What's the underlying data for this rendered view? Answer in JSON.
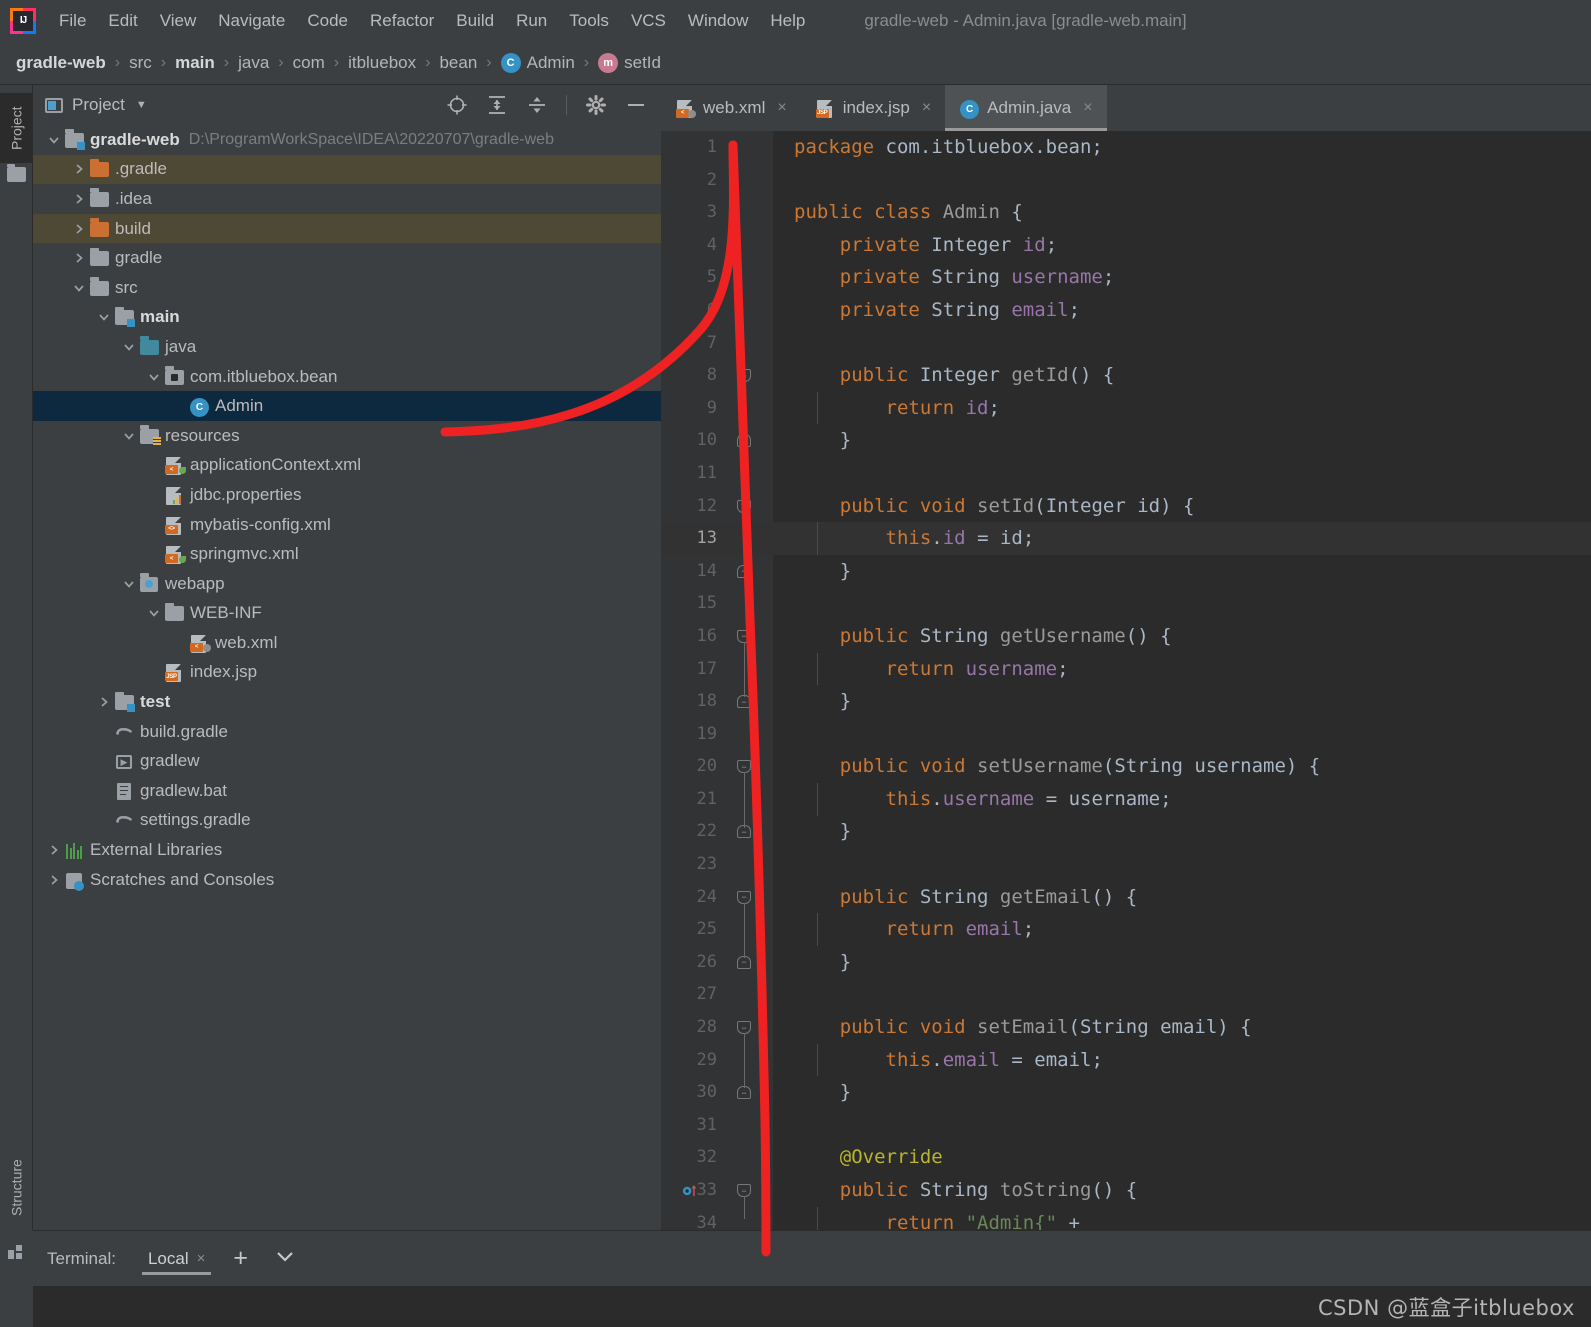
{
  "app": {
    "logo": "intellij-idea-logo",
    "window_title": "gradle-web - Admin.java [gradle-web.main]"
  },
  "menubar": {
    "items": [
      {
        "label": "File"
      },
      {
        "label": "Edit"
      },
      {
        "label": "View"
      },
      {
        "label": "Navigate"
      },
      {
        "label": "Code"
      },
      {
        "label": "Refactor"
      },
      {
        "label": "Build"
      },
      {
        "label": "Run"
      },
      {
        "label": "Tools"
      },
      {
        "label": "VCS"
      },
      {
        "label": "Window"
      },
      {
        "label": "Help"
      }
    ]
  },
  "breadcrumb": {
    "items": [
      {
        "label": "gradle-web",
        "bold": true,
        "icon": ""
      },
      {
        "label": "src",
        "bold": false,
        "icon": ""
      },
      {
        "label": "main",
        "bold": true,
        "icon": ""
      },
      {
        "label": "java",
        "bold": false,
        "icon": ""
      },
      {
        "label": "com",
        "bold": false,
        "icon": ""
      },
      {
        "label": "itbluebox",
        "bold": false,
        "icon": ""
      },
      {
        "label": "bean",
        "bold": false,
        "icon": ""
      },
      {
        "label": "Admin",
        "bold": false,
        "icon": "class-badge"
      },
      {
        "label": "setId",
        "bold": false,
        "icon": "method-badge"
      }
    ],
    "separator": "›",
    "class_badge_letter": "C",
    "method_badge_letter": "m"
  },
  "toolstrip": {
    "project_label": "Project",
    "structure_label": "Structure"
  },
  "project_panel": {
    "title": "Project",
    "caret": "▼",
    "toolbar_icons": [
      "locate-target-icon",
      "expand-all-icon",
      "collapse-all-icon",
      "gear-icon",
      "minimize-icon"
    ],
    "tree": [
      {
        "depth": 0,
        "label": "gradle-web",
        "path": "D:\\ProgramWorkSpace\\IDEA\\20220707\\gradle-web",
        "arrow": "down",
        "icon": "module-folder",
        "bold": true,
        "state": "normal"
      },
      {
        "depth": 1,
        "label": ".gradle",
        "path": "",
        "arrow": "right",
        "icon": "folder-orange",
        "bold": false,
        "state": "excluded"
      },
      {
        "depth": 1,
        "label": ".idea",
        "path": "",
        "arrow": "right",
        "icon": "folder-gray",
        "bold": false,
        "state": "normal"
      },
      {
        "depth": 1,
        "label": "build",
        "path": "",
        "arrow": "right",
        "icon": "folder-orange",
        "bold": false,
        "state": "excluded"
      },
      {
        "depth": 1,
        "label": "gradle",
        "path": "",
        "arrow": "right",
        "icon": "folder-gray",
        "bold": false,
        "state": "normal"
      },
      {
        "depth": 1,
        "label": "src",
        "path": "",
        "arrow": "down",
        "icon": "folder-gray",
        "bold": false,
        "state": "normal"
      },
      {
        "depth": 2,
        "label": "main",
        "path": "",
        "arrow": "down",
        "icon": "module-folder",
        "bold": true,
        "state": "normal"
      },
      {
        "depth": 3,
        "label": "java",
        "path": "",
        "arrow": "down",
        "icon": "folder-teal",
        "bold": false,
        "state": "normal"
      },
      {
        "depth": 4,
        "label": "com.itbluebox.bean",
        "path": "",
        "arrow": "down",
        "icon": "package-icon",
        "bold": false,
        "state": "normal"
      },
      {
        "depth": 5,
        "label": "Admin",
        "path": "",
        "arrow": "none",
        "icon": "java-class",
        "bold": false,
        "state": "selected"
      },
      {
        "depth": 3,
        "label": "resources",
        "path": "",
        "arrow": "down",
        "icon": "folder-resources",
        "bold": false,
        "state": "normal"
      },
      {
        "depth": 4,
        "label": "applicationContext.xml",
        "path": "",
        "arrow": "none",
        "icon": "spring-xml",
        "bold": false,
        "state": "normal"
      },
      {
        "depth": 4,
        "label": "jdbc.properties",
        "path": "",
        "arrow": "none",
        "icon": "properties-file",
        "bold": false,
        "state": "normal"
      },
      {
        "depth": 4,
        "label": "mybatis-config.xml",
        "path": "",
        "arrow": "none",
        "icon": "xml-file",
        "bold": false,
        "state": "normal"
      },
      {
        "depth": 4,
        "label": "springmvc.xml",
        "path": "",
        "arrow": "none",
        "icon": "spring-xml",
        "bold": false,
        "state": "normal"
      },
      {
        "depth": 3,
        "label": "webapp",
        "path": "",
        "arrow": "down",
        "icon": "webapp-folder",
        "bold": false,
        "state": "normal"
      },
      {
        "depth": 4,
        "label": "WEB-INF",
        "path": "",
        "arrow": "down",
        "icon": "folder-gray",
        "bold": false,
        "state": "normal"
      },
      {
        "depth": 5,
        "label": "web.xml",
        "path": "",
        "arrow": "none",
        "icon": "web-xml",
        "bold": false,
        "state": "normal"
      },
      {
        "depth": 4,
        "label": "index.jsp",
        "path": "",
        "arrow": "none",
        "icon": "jsp-file",
        "bold": false,
        "state": "normal"
      },
      {
        "depth": 2,
        "label": "test",
        "path": "",
        "arrow": "right",
        "icon": "module-folder",
        "bold": true,
        "state": "normal"
      },
      {
        "depth": 2,
        "label": "build.gradle",
        "path": "",
        "arrow": "none",
        "icon": "gradle-file",
        "bold": false,
        "state": "normal"
      },
      {
        "depth": 2,
        "label": "gradlew",
        "path": "",
        "arrow": "none",
        "icon": "script-file",
        "bold": false,
        "state": "normal"
      },
      {
        "depth": 2,
        "label": "gradlew.bat",
        "path": "",
        "arrow": "none",
        "icon": "bat-file",
        "bold": false,
        "state": "normal"
      },
      {
        "depth": 2,
        "label": "settings.gradle",
        "path": "",
        "arrow": "none",
        "icon": "gradle-file",
        "bold": false,
        "state": "normal"
      },
      {
        "depth": 0,
        "label": "External Libraries",
        "path": "",
        "arrow": "right",
        "icon": "libraries-icon",
        "bold": false,
        "state": "normal"
      },
      {
        "depth": 0,
        "label": "Scratches and Consoles",
        "path": "",
        "arrow": "right",
        "icon": "scratches-icon",
        "bold": false,
        "state": "normal"
      }
    ]
  },
  "editor": {
    "tabs": [
      {
        "label": "web.xml",
        "icon": "web-xml-icon",
        "active": false,
        "close": "×"
      },
      {
        "label": "index.jsp",
        "icon": "jsp-icon",
        "active": false,
        "close": "×"
      },
      {
        "label": "Admin.java",
        "icon": "java-class-icon",
        "active": true,
        "close": "×"
      }
    ],
    "current_line": 13,
    "first_line": 1,
    "last_line": 34,
    "lines": [
      {
        "n": 1,
        "fold": "none",
        "tokens": [
          {
            "t": "package ",
            "c": "kw"
          },
          {
            "t": "com.itbluebox.bean;",
            "c": "pln"
          }
        ]
      },
      {
        "n": 2,
        "fold": "none",
        "tokens": []
      },
      {
        "n": 3,
        "fold": "none",
        "tokens": [
          {
            "t": "public class ",
            "c": "kw"
          },
          {
            "t": "Admin",
            "c": "mth"
          },
          {
            "t": " {",
            "c": "pln"
          }
        ]
      },
      {
        "n": 4,
        "fold": "none",
        "tokens": [
          {
            "t": "    private ",
            "c": "kw"
          },
          {
            "t": "Integer ",
            "c": "typ"
          },
          {
            "t": "id",
            "c": "fld"
          },
          {
            "t": ";",
            "c": "pln"
          }
        ]
      },
      {
        "n": 5,
        "fold": "none",
        "tokens": [
          {
            "t": "    private ",
            "c": "kw"
          },
          {
            "t": "String ",
            "c": "typ"
          },
          {
            "t": "username",
            "c": "fld"
          },
          {
            "t": ";",
            "c": "pln"
          }
        ]
      },
      {
        "n": 6,
        "fold": "none",
        "tokens": [
          {
            "t": "    private ",
            "c": "kw"
          },
          {
            "t": "String ",
            "c": "typ"
          },
          {
            "t": "email",
            "c": "fld"
          },
          {
            "t": ";",
            "c": "pln"
          }
        ]
      },
      {
        "n": 7,
        "fold": "none",
        "tokens": []
      },
      {
        "n": 8,
        "fold": "open",
        "tokens": [
          {
            "t": "    public ",
            "c": "kw"
          },
          {
            "t": "Integer ",
            "c": "typ"
          },
          {
            "t": "getId",
            "c": "mth"
          },
          {
            "t": "() {",
            "c": "pln"
          }
        ]
      },
      {
        "n": 9,
        "fold": "none",
        "tokens": [
          {
            "t": "        return ",
            "c": "kw"
          },
          {
            "t": "id",
            "c": "fld"
          },
          {
            "t": ";",
            "c": "pln"
          }
        ]
      },
      {
        "n": 10,
        "fold": "close",
        "tokens": [
          {
            "t": "    }",
            "c": "pln"
          }
        ]
      },
      {
        "n": 11,
        "fold": "none",
        "tokens": []
      },
      {
        "n": 12,
        "fold": "open",
        "tokens": [
          {
            "t": "    public void ",
            "c": "kw"
          },
          {
            "t": "setId",
            "c": "mth"
          },
          {
            "t": "(",
            "c": "pln"
          },
          {
            "t": "Integer",
            "c": "typ"
          },
          {
            "t": " id) {",
            "c": "pln"
          }
        ]
      },
      {
        "n": 13,
        "fold": "none",
        "tokens": [
          {
            "t": "        this",
            "c": "kw"
          },
          {
            "t": ".",
            "c": "pln"
          },
          {
            "t": "id",
            "c": "fld"
          },
          {
            "t": " = id;",
            "c": "pln"
          }
        ]
      },
      {
        "n": 14,
        "fold": "close",
        "tokens": [
          {
            "t": "    }",
            "c": "pln"
          }
        ]
      },
      {
        "n": 15,
        "fold": "none",
        "tokens": []
      },
      {
        "n": 16,
        "fold": "open",
        "tokens": [
          {
            "t": "    public ",
            "c": "kw"
          },
          {
            "t": "String ",
            "c": "typ"
          },
          {
            "t": "getUsername",
            "c": "mth"
          },
          {
            "t": "() {",
            "c": "pln"
          }
        ]
      },
      {
        "n": 17,
        "fold": "none",
        "tokens": [
          {
            "t": "        return ",
            "c": "kw"
          },
          {
            "t": "username",
            "c": "fld"
          },
          {
            "t": ";",
            "c": "pln"
          }
        ]
      },
      {
        "n": 18,
        "fold": "close",
        "tokens": [
          {
            "t": "    }",
            "c": "pln"
          }
        ]
      },
      {
        "n": 19,
        "fold": "none",
        "tokens": []
      },
      {
        "n": 20,
        "fold": "open",
        "tokens": [
          {
            "t": "    public void ",
            "c": "kw"
          },
          {
            "t": "setUsername",
            "c": "mth"
          },
          {
            "t": "(",
            "c": "pln"
          },
          {
            "t": "String",
            "c": "typ"
          },
          {
            "t": " username) {",
            "c": "pln"
          }
        ]
      },
      {
        "n": 21,
        "fold": "none",
        "tokens": [
          {
            "t": "        this",
            "c": "kw"
          },
          {
            "t": ".",
            "c": "pln"
          },
          {
            "t": "username",
            "c": "fld"
          },
          {
            "t": " = username;",
            "c": "pln"
          }
        ]
      },
      {
        "n": 22,
        "fold": "close",
        "tokens": [
          {
            "t": "    }",
            "c": "pln"
          }
        ]
      },
      {
        "n": 23,
        "fold": "none",
        "tokens": []
      },
      {
        "n": 24,
        "fold": "open",
        "tokens": [
          {
            "t": "    public ",
            "c": "kw"
          },
          {
            "t": "String ",
            "c": "typ"
          },
          {
            "t": "getEmail",
            "c": "mth"
          },
          {
            "t": "() {",
            "c": "pln"
          }
        ]
      },
      {
        "n": 25,
        "fold": "none",
        "tokens": [
          {
            "t": "        return ",
            "c": "kw"
          },
          {
            "t": "email",
            "c": "fld"
          },
          {
            "t": ";",
            "c": "pln"
          }
        ]
      },
      {
        "n": 26,
        "fold": "close",
        "tokens": [
          {
            "t": "    }",
            "c": "pln"
          }
        ]
      },
      {
        "n": 27,
        "fold": "none",
        "tokens": []
      },
      {
        "n": 28,
        "fold": "open",
        "tokens": [
          {
            "t": "    public void ",
            "c": "kw"
          },
          {
            "t": "setEmail",
            "c": "mth"
          },
          {
            "t": "(",
            "c": "pln"
          },
          {
            "t": "String",
            "c": "typ"
          },
          {
            "t": " email) {",
            "c": "pln"
          }
        ]
      },
      {
        "n": 29,
        "fold": "none",
        "tokens": [
          {
            "t": "        this",
            "c": "kw"
          },
          {
            "t": ".",
            "c": "pln"
          },
          {
            "t": "email",
            "c": "fld"
          },
          {
            "t": " = email;",
            "c": "pln"
          }
        ]
      },
      {
        "n": 30,
        "fold": "close",
        "tokens": [
          {
            "t": "    }",
            "c": "pln"
          }
        ]
      },
      {
        "n": 31,
        "fold": "none",
        "tokens": []
      },
      {
        "n": 32,
        "fold": "none",
        "tokens": [
          {
            "t": "    @Override",
            "c": "ann"
          }
        ]
      },
      {
        "n": 33,
        "fold": "open",
        "gutter_icon": "overriding-method-icon",
        "tokens": [
          {
            "t": "    public ",
            "c": "kw"
          },
          {
            "t": "String ",
            "c": "typ"
          },
          {
            "t": "toString",
            "c": "mth"
          },
          {
            "t": "() {",
            "c": "pln"
          }
        ]
      },
      {
        "n": 34,
        "fold": "none",
        "tokens": [
          {
            "t": "        return ",
            "c": "kw"
          },
          {
            "t": "\"Admin{\"",
            "c": "str"
          },
          {
            "t": " +",
            "c": "pln"
          }
        ]
      }
    ]
  },
  "terminal": {
    "label": "Terminal:",
    "tab_label": "Local",
    "tab_close": "×",
    "add": "+",
    "caret": "⌄"
  },
  "watermark": {
    "text": "CSDN @蓝盒子itbluebox"
  },
  "annotation": {
    "color": "#ee2222",
    "description": "red-hand-drawn-arrow"
  },
  "colors": {
    "bg_panel": "#3c3f41",
    "bg_editor": "#2b2b2b",
    "gutter": "#313335",
    "selection": "#0d293f",
    "excluded": "#4e4934",
    "keyword": "#cc7832",
    "field": "#9876aa",
    "string": "#6a8759",
    "annotation": "#bbb529",
    "accent": "#3592c4"
  }
}
